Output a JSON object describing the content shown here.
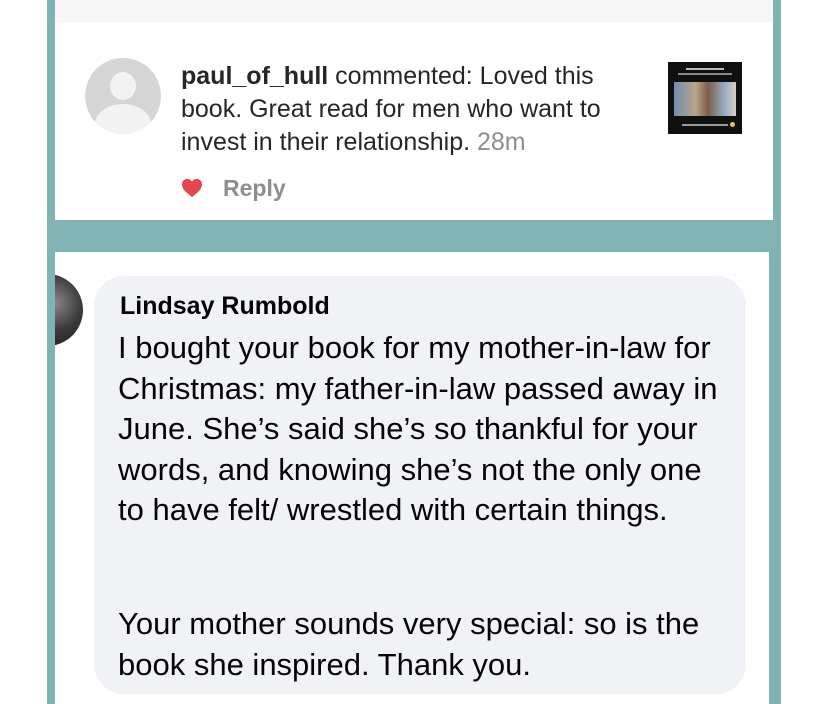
{
  "notification": {
    "username": "paul_of_hull",
    "message": " commented: Loved this book. Great read for men who want to invest in their relationship. ",
    "time": "28m",
    "reply_label": "Reply",
    "heart_color": "#e0474f"
  },
  "comment": {
    "author": "Lindsay Rumbold",
    "paragraph1": "I bought your book for my mother-in-law for Christmas: my father-in-law passed away in June. She’s said she’s so thankful for your words, and knowing she’s not the only one to have felt/ wrestled with certain things.",
    "paragraph2": "Your mother sounds very special: so is the book she inspired. Thank you.",
    "bubble_color": "#f0f2f5"
  },
  "frame_color": "#7fb3b4"
}
